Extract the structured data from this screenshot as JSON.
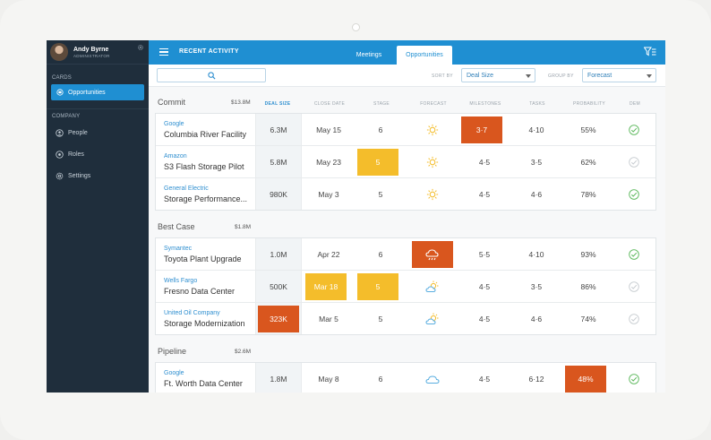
{
  "sidebar": {
    "user_name": "Andy Byrne",
    "user_role": "ADMINISTRATOR",
    "cards_label": "CARDS",
    "active_item": "Opportunities",
    "company_label": "COMPANY",
    "items": [
      {
        "label": "People",
        "icon": "people-icon"
      },
      {
        "label": "Roles",
        "icon": "roles-icon"
      },
      {
        "label": "Settings",
        "icon": "settings-icon"
      }
    ]
  },
  "topbar": {
    "title": "RECENT ACTIVITY",
    "tabs": [
      "Meetings",
      "Opportunities"
    ],
    "active_tab": "Opportunities"
  },
  "filters": {
    "search_placeholder": "",
    "sort_label": "SORT BY",
    "sort_value": "Deal Size",
    "group_label": "GROUP BY",
    "group_value": "Forecast"
  },
  "columns": [
    "DEAL SIZE",
    "CLOSE DATE",
    "STAGE",
    "FORECAST",
    "MILESTONES",
    "TASKS",
    "PROBABILITY",
    "DEM"
  ],
  "colors": {
    "accent": "#1f8fd2",
    "highlight_yellow": "#f4bd2b",
    "highlight_red": "#d9561e",
    "check_green": "#5cb85c",
    "sidebar_bg": "#1f2e3c"
  },
  "groups": [
    {
      "name": "Commit",
      "amount": "$13.8M",
      "rows": [
        {
          "company": "Google",
          "name": "Columbia River Facility",
          "deal": "6.3M",
          "date": "May 15",
          "stage": "6",
          "forecast": "sun-icon",
          "milestones": "3·7",
          "tasks": "4·10",
          "probability": "55%",
          "dem": "check-green",
          "hl_milestones": "red"
        },
        {
          "company": "Amazon",
          "name": "S3 Flash Storage Pilot",
          "deal": "5.8M",
          "date": "May 23",
          "stage": "5",
          "forecast": "sun-icon",
          "milestones": "4·5",
          "tasks": "3·5",
          "probability": "62%",
          "dem": "check-gray",
          "hl_stage": "yellow"
        },
        {
          "company": "General Electric",
          "name": "Storage Performance...",
          "deal": "980K",
          "date": "May 3",
          "stage": "5",
          "forecast": "sun-icon",
          "milestones": "4·5",
          "tasks": "4·6",
          "probability": "78%",
          "dem": "check-green"
        }
      ]
    },
    {
      "name": "Best Case",
      "amount": "$1.8M",
      "rows": [
        {
          "company": "Symantec",
          "name": "Toyota Plant Upgrade",
          "deal": "1.0M",
          "date": "Apr 22",
          "stage": "6",
          "forecast": "storm-icon",
          "milestones": "5·5",
          "tasks": "4·10",
          "probability": "93%",
          "dem": "check-green",
          "hl_forecast": "red"
        },
        {
          "company": "Wells Fargo",
          "name": "Fresno Data Center",
          "deal": "500K",
          "date": "Mar 18",
          "stage": "5",
          "forecast": "partly-cloudy-icon",
          "milestones": "4·5",
          "tasks": "3·5",
          "probability": "86%",
          "dem": "check-gray",
          "hl_date": "yellow",
          "hl_stage": "yellow"
        },
        {
          "company": "United Oil Company",
          "name": "Storage Modernization",
          "deal": "323K",
          "date": "Mar 5",
          "stage": "5",
          "forecast": "partly-cloudy-icon",
          "milestones": "4·5",
          "tasks": "4·6",
          "probability": "74%",
          "dem": "check-gray",
          "hl_deal": "red"
        }
      ]
    },
    {
      "name": "Pipeline",
      "amount": "$2.6M",
      "rows": [
        {
          "company": "Google",
          "name": "Ft. Worth Data Center",
          "deal": "1.8M",
          "date": "May 8",
          "stage": "6",
          "forecast": "cloud-icon",
          "milestones": "4·5",
          "tasks": "6·12",
          "probability": "48%",
          "dem": "check-green",
          "hl_probability": "red"
        }
      ]
    }
  ]
}
